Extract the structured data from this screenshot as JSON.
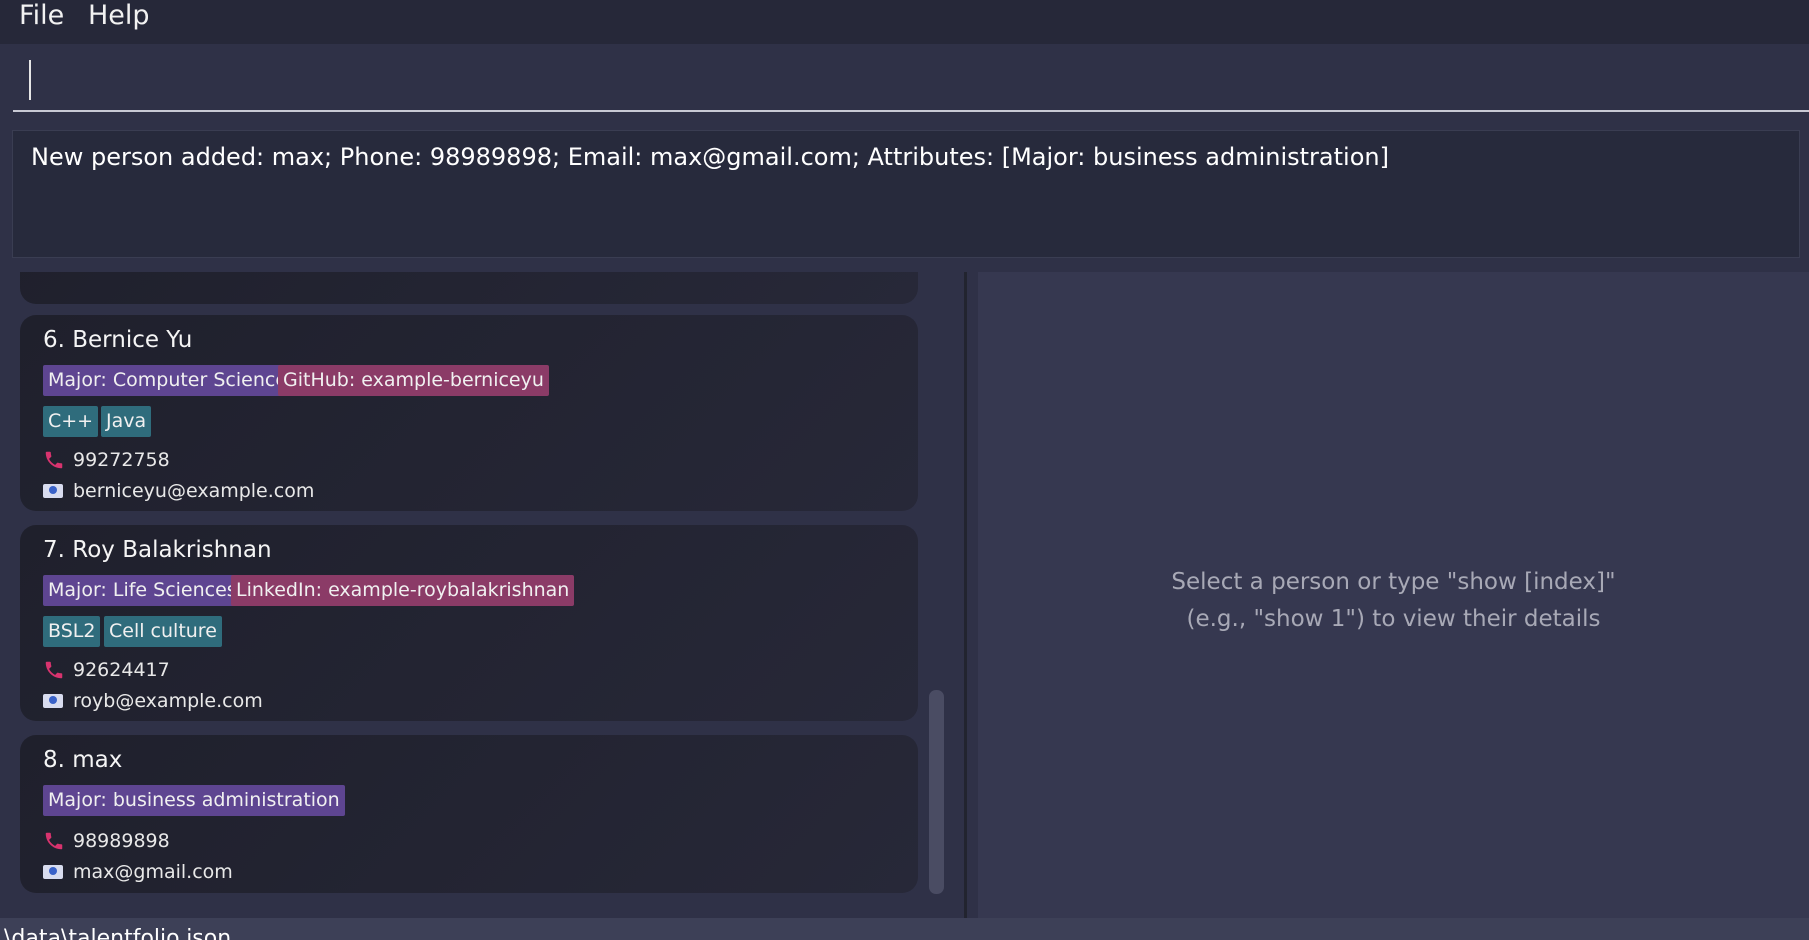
{
  "menu": {
    "file": "File",
    "help": "Help"
  },
  "command": {
    "value": "",
    "placeholder": ""
  },
  "result": {
    "message": "New person added: max; Phone: 98989898; Email: max@gmail.com; Attributes: [Major: business administration]"
  },
  "persons": [
    {
      "name": "6. Bernice Yu",
      "attributes": [
        "Major: Computer Science",
        "GitHub: example-berniceyu"
      ],
      "tags": [
        "C++",
        "Java"
      ],
      "phone": "99272758",
      "email": "berniceyu@example.com"
    },
    {
      "name": "7. Roy Balakrishnan",
      "attributes": [
        "Major: Life Sciences",
        "LinkedIn: example-roybalakrishnan"
      ],
      "tags": [
        "BSL2",
        "Cell culture"
      ],
      "phone": "92624417",
      "email": "royb@example.com"
    },
    {
      "name": "8. max",
      "attributes": [
        "Major: business administration"
      ],
      "tags": [],
      "phone": "98989898",
      "email": "max@gmail.com"
    }
  ],
  "detail": {
    "line1": "Select a person or type \"show [index]\"",
    "line2": "(e.g., \"show 1\") to view their details"
  },
  "status": {
    "path": "\\data\\talentfolio.json"
  },
  "colors": {
    "major_chip": "#5e4591",
    "link_chip": "#8b3b67",
    "skill_chip": "#2f6c7c",
    "phone_icon": "#d8336e"
  },
  "icons": {
    "phone": "phone-icon",
    "email": "email-icon"
  }
}
